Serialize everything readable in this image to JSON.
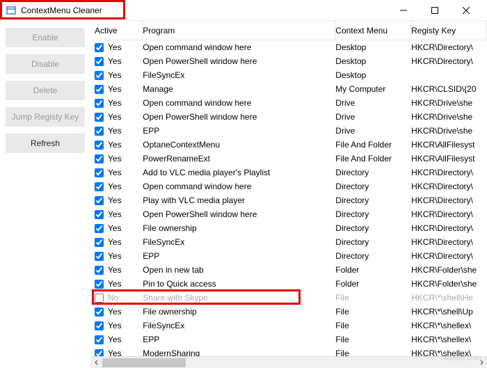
{
  "window": {
    "title": "ContextMenu Cleaner"
  },
  "sidebar": {
    "enable": "Enable",
    "disable": "Disable",
    "delete": "Delete",
    "jump": "Jump Registy Key",
    "refresh": "Refresh"
  },
  "columns": {
    "active": "Active",
    "program": "Program",
    "context": "Context Menu",
    "reg": "Registy Key"
  },
  "rows": [
    {
      "checked": true,
      "active": "Yes",
      "program": "Open command window here",
      "context": "Desktop",
      "reg": "HKCR\\Directory\\"
    },
    {
      "checked": true,
      "active": "Yes",
      "program": "Open PowerShell window here",
      "context": "Desktop",
      "reg": "HKCR\\Directory\\"
    },
    {
      "checked": true,
      "active": "Yes",
      "program": " FileSyncEx",
      "context": "Desktop",
      "reg": ""
    },
    {
      "checked": true,
      "active": "Yes",
      "program": "Manage",
      "context": "My Computer",
      "reg": "HKCR\\CLSID\\{20"
    },
    {
      "checked": true,
      "active": "Yes",
      "program": "Open command window here",
      "context": "Drive",
      "reg": "HKCR\\Drive\\she"
    },
    {
      "checked": true,
      "active": "Yes",
      "program": "Open PowerShell window here",
      "context": "Drive",
      "reg": "HKCR\\Drive\\she"
    },
    {
      "checked": true,
      "active": "Yes",
      "program": "EPP",
      "context": "Drive",
      "reg": "HKCR\\Drive\\she"
    },
    {
      "checked": true,
      "active": "Yes",
      "program": "OptaneContextMenu",
      "context": "File And Folder",
      "reg": "HKCR\\AllFilesyst"
    },
    {
      "checked": true,
      "active": "Yes",
      "program": "PowerRenameExt",
      "context": "File And Folder",
      "reg": "HKCR\\AllFilesyst"
    },
    {
      "checked": true,
      "active": "Yes",
      "program": "Add to VLC media player's Playlist",
      "context": "Directory",
      "reg": "HKCR\\Directory\\"
    },
    {
      "checked": true,
      "active": "Yes",
      "program": "Open command window here",
      "context": "Directory",
      "reg": "HKCR\\Directory\\"
    },
    {
      "checked": true,
      "active": "Yes",
      "program": "Play with VLC media player",
      "context": "Directory",
      "reg": "HKCR\\Directory\\"
    },
    {
      "checked": true,
      "active": "Yes",
      "program": "Open PowerShell window here",
      "context": "Directory",
      "reg": "HKCR\\Directory\\"
    },
    {
      "checked": true,
      "active": "Yes",
      "program": "File ownership",
      "context": "Directory",
      "reg": "HKCR\\Directory\\"
    },
    {
      "checked": true,
      "active": "Yes",
      "program": " FileSyncEx",
      "context": "Directory",
      "reg": "HKCR\\Directory\\"
    },
    {
      "checked": true,
      "active": "Yes",
      "program": "EPP",
      "context": "Directory",
      "reg": "HKCR\\Directory\\"
    },
    {
      "checked": true,
      "active": "Yes",
      "program": "Open in new tab",
      "context": "Folder",
      "reg": "HKCR\\Folder\\she"
    },
    {
      "checked": true,
      "active": "Yes",
      "program": "Pin to Quick access",
      "context": "Folder",
      "reg": "HKCR\\Folder\\she"
    },
    {
      "checked": false,
      "active": "No",
      "program": "Share with Skype",
      "context": "File",
      "reg": "HKCR\\*\\shell\\He",
      "disabled": true
    },
    {
      "checked": true,
      "active": "Yes",
      "program": "File ownership",
      "context": "File",
      "reg": "HKCR\\*\\shell\\Up"
    },
    {
      "checked": true,
      "active": "Yes",
      "program": " FileSyncEx",
      "context": "File",
      "reg": "HKCR\\*\\shellex\\"
    },
    {
      "checked": true,
      "active": "Yes",
      "program": "EPP",
      "context": "File",
      "reg": "HKCR\\*\\shellex\\"
    },
    {
      "checked": true,
      "active": "Yes",
      "program": "ModernSharing",
      "context": "File",
      "reg": "HKCR\\*\\shellex\\"
    }
  ],
  "watermark": "wsxdn.com"
}
